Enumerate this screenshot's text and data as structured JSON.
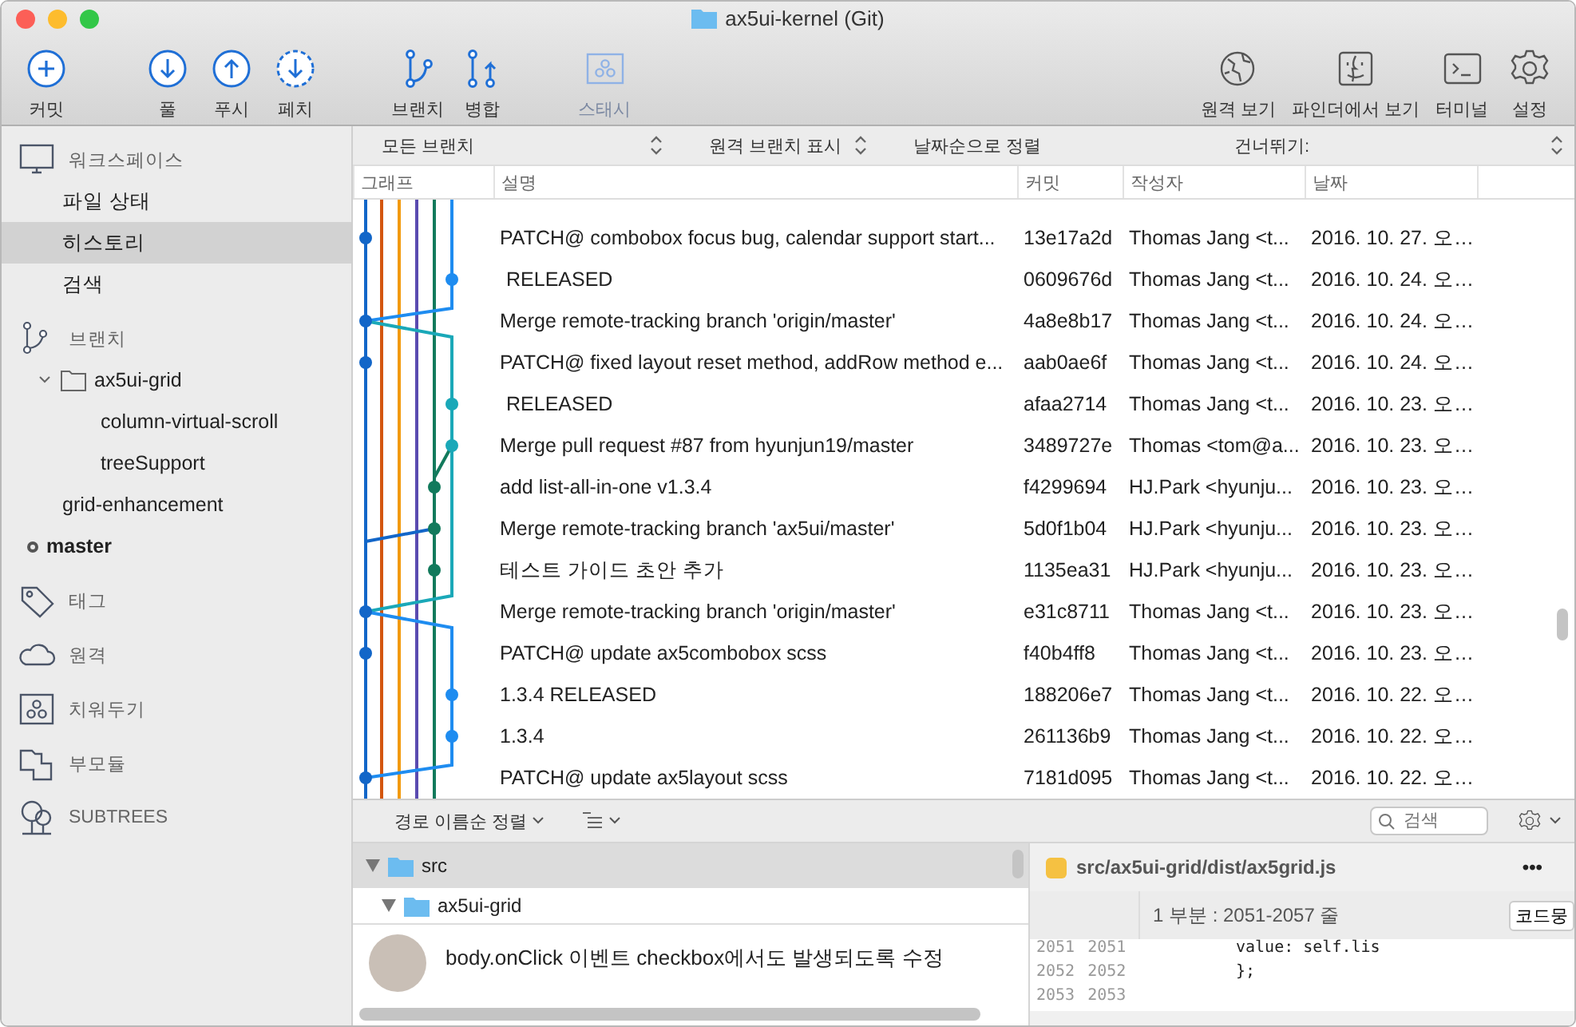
{
  "window": {
    "title": "ax5ui-kernel (Git)"
  },
  "toolbar": {
    "groups": [
      [
        {
          "label": "커밋",
          "kind": "commit",
          "disabled": false
        }
      ],
      [
        {
          "label": "풀",
          "kind": "pull",
          "disabled": false
        },
        {
          "label": "푸시",
          "kind": "push",
          "disabled": false
        },
        {
          "label": "페치",
          "kind": "fetch",
          "disabled": false
        }
      ],
      [
        {
          "label": "브랜치",
          "kind": "branch",
          "disabled": false
        },
        {
          "label": "병합",
          "kind": "merge",
          "disabled": false
        }
      ],
      [
        {
          "label": "스태시",
          "kind": "stash",
          "disabled": true
        }
      ]
    ],
    "right": [
      {
        "label": "원격 보기",
        "kind": "globe",
        "disabled": false
      },
      {
        "label": "파인더에서 보기",
        "kind": "finder",
        "disabled": false
      },
      {
        "label": "터미널",
        "kind": "terminal",
        "disabled": false
      },
      {
        "label": "설정",
        "kind": "settings",
        "disabled": false
      }
    ]
  },
  "sidebar": {
    "sections": [
      {
        "label": "워크스페이스",
        "kind": "workspace",
        "items": [
          {
            "label": "파일 상태",
            "selected": false
          },
          {
            "label": "히스토리",
            "selected": true
          },
          {
            "label": "검색",
            "selected": false
          }
        ]
      },
      {
        "label": "브랜치",
        "kind": "branch",
        "items": [
          {
            "label": "ax5ui-grid",
            "expanded": true,
            "children": [
              {
                "label": "column-virtual-scroll",
                "current": false
              },
              {
                "label": "treeSupport",
                "current": false
              }
            ]
          },
          {
            "label": "grid-enhancement",
            "current": false
          },
          {
            "label": "master",
            "current": true
          }
        ]
      },
      {
        "label": "태그",
        "kind": "tag"
      },
      {
        "label": "원격",
        "kind": "remote"
      },
      {
        "label": "치워두기",
        "kind": "stash"
      },
      {
        "label": "부모듈",
        "kind": "submodule"
      },
      {
        "label": "SUBTREES",
        "kind": "subtree"
      }
    ]
  },
  "filters": [
    {
      "label": "모든 브랜치"
    },
    {
      "label": "원격 브랜치 표시"
    },
    {
      "label": "날짜순으로 정렬"
    }
  ],
  "jump": {
    "label": "건너뛰기:"
  },
  "table": {
    "columns": [
      "그래프",
      "설명",
      "커밋",
      "작성자",
      "날짜"
    ],
    "rows": [
      {
        "description": "PATCH@ combobox focus bug, calendar support start...",
        "commit": "13e17a2d",
        "author": "Thomas Jang <t...",
        "date": "2016. 10. 27. 오…"
      },
      {
        "description": "RELEASED",
        "commit": "0609676d",
        "author": "Thomas Jang <t...",
        "date": "2016. 10. 24. 오…"
      },
      {
        "description": "Merge remote-tracking branch 'origin/master'",
        "commit": "4a8e8b17",
        "author": "Thomas Jang <t...",
        "date": "2016. 10. 24. 오…"
      },
      {
        "description": "PATCH@ fixed layout reset method, addRow method e...",
        "commit": "aab0ae6f",
        "author": "Thomas Jang <t...",
        "date": "2016. 10. 24. 오…"
      },
      {
        "description": "RELEASED",
        "commit": "afaa2714",
        "author": "Thomas Jang <t...",
        "date": "2016. 10. 23. 오…"
      },
      {
        "description": "Merge pull request #87 from hyunjun19/master",
        "commit": "3489727e",
        "author": "Thomas <tom@a...",
        "date": "2016. 10. 23. 오…"
      },
      {
        "description": "add list-all-in-one v1.3.4",
        "commit": "f4299694",
        "author": "HJ.Park <hyunju...",
        "date": "2016. 10. 23. 오…"
      },
      {
        "description": "Merge remote-tracking branch 'ax5ui/master'",
        "commit": "5d0f1b04",
        "author": "HJ.Park <hyunju...",
        "date": "2016. 10. 23. 오…"
      },
      {
        "description": "테스트 가이드 초안 추가",
        "commit": "1135ea31",
        "author": "HJ.Park <hyunju...",
        "date": "2016. 10. 23. 오…"
      },
      {
        "description": "Merge remote-tracking branch 'origin/master'",
        "commit": "e31c8711",
        "author": "Thomas Jang <t...",
        "date": "2016. 10. 23. 오…"
      },
      {
        "description": "PATCH@ update ax5combobox scss",
        "commit": "f40b4ff8",
        "author": "Thomas Jang <t...",
        "date": "2016. 10. 23. 오…"
      },
      {
        "description": "1.3.4 RELEASED",
        "commit": "188206e7",
        "author": "Thomas Jang <t...",
        "date": "2016. 10. 22. 오…"
      },
      {
        "description": "1.3.4",
        "commit": "261136b9",
        "author": "Thomas Jang <t...",
        "date": "2016. 10. 22. 오…"
      },
      {
        "description": "PATCH@ update ax5layout scss",
        "commit": "7181d095",
        "author": "Thomas Jang <t...",
        "date": "2016. 10. 22. 오…"
      }
    ]
  },
  "bottom": {
    "sort": "경로 이름순 정렬",
    "search": {
      "placeholder": "검색"
    },
    "files": [
      {
        "name": "src",
        "selected": true,
        "expanded": true,
        "children": [
          {
            "name": "ax5ui-grid",
            "selected": false,
            "expanded": true
          }
        ]
      }
    ],
    "commit_message": "body.onClick 이벤트 checkbox에서도 발생되도록 수정",
    "diff": {
      "file": "src/ax5ui-grid/dist/ax5grid.js",
      "menu": "•••",
      "hunk": "1 부분 : 2051-2057 줄",
      "hunk_button": "코드뭉",
      "lines": [
        {
          "old": "2051",
          "new": "2051",
          "text": "value: self.lis"
        },
        {
          "old": "2052",
          "new": "2052",
          "text": "};"
        },
        {
          "old": "2053",
          "new": "2053"
        }
      ]
    }
  }
}
